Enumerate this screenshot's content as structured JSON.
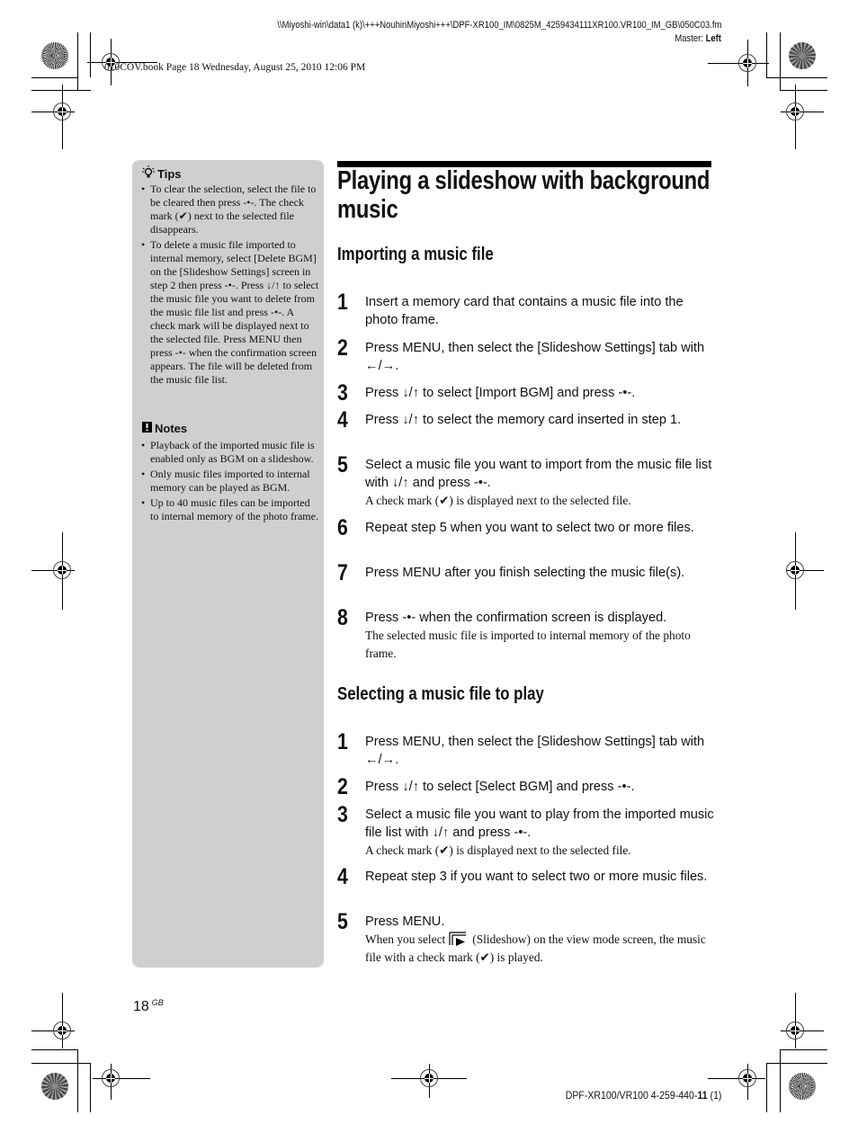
{
  "header": {
    "file_path": "\\\\Miyoshi-win\\data1 (k)\\+++NouhinMiyoshi+++\\DPF-XR100_IM\\0825M_4259434111XR100.VR100_IM_GB\\050C03.fm",
    "master_label": "Master:",
    "master_value": "Left",
    "book_info": "010COV.book  Page 18  Wednesday, August 25, 2010  12:06 PM"
  },
  "sidebar": {
    "tips": {
      "icon": "lightbulb-icon",
      "heading": "Tips",
      "items": [
        "To clear the selection, select the file to be cleared then press -•-. The check mark (✔) next to the selected file disappears.",
        "To delete a music file imported to internal memory, select [Delete BGM] on the [Slideshow Settings] screen in step 2 then press -•-. Press ↓/↑ to select the music file you want to delete from the music file list and press -•-. A check mark will be displayed next to the selected file. Press MENU then press -•- when the confirmation screen appears. The file will be deleted from the music file list."
      ]
    },
    "notes": {
      "icon": "exclamation-icon",
      "heading": "Notes",
      "items": [
        "Playback of the imported music file is enabled only as BGM on a slideshow.",
        "Only music files imported to internal memory can be played as BGM.",
        "Up to 40 music files can be imported to internal memory of the photo frame."
      ]
    }
  },
  "main": {
    "title": "Playing a slideshow with background music",
    "sections": [
      {
        "heading": "Importing a music file",
        "steps": [
          {
            "num": "1",
            "text": "Insert a memory card that contains a music file into the photo frame.",
            "sub": ""
          },
          {
            "num": "2",
            "text": "Press MENU, then select the [Slideshow Settings] tab with ←/→.",
            "sub": ""
          },
          {
            "num": "3",
            "text": "Press ↓/↑ to select [Import BGM] and press -•-.",
            "sub": ""
          },
          {
            "num": "4",
            "text": "Press ↓/↑ to select the memory card inserted in step 1.",
            "sub": ""
          },
          {
            "num": "5",
            "text": "Select a music file you want to import from the music file list with ↓/↑ and press -•-.",
            "sub": "A check mark (✔) is displayed next to the selected file."
          },
          {
            "num": "6",
            "text": "Repeat step 5 when you want to select two or more files.",
            "sub": ""
          },
          {
            "num": "7",
            "text": "Press MENU after you finish selecting the music file(s).",
            "sub": ""
          },
          {
            "num": "8",
            "text": "Press -•- when the confirmation screen is displayed.",
            "sub": "The selected music file is imported to internal memory of the photo frame."
          }
        ]
      },
      {
        "heading": "Selecting a music file to play",
        "steps": [
          {
            "num": "1",
            "text": "Press MENU, then select the [Slideshow Settings] tab with ←/→.",
            "sub": ""
          },
          {
            "num": "2",
            "text": "Press ↓/↑ to select [Select BGM] and press -•-.",
            "sub": ""
          },
          {
            "num": "3",
            "text": "Select a music file you want to play from the imported music file list with ↓/↑ and press -•-.",
            "sub": "A check mark (✔) is displayed next to the selected file."
          },
          {
            "num": "4",
            "text": "Repeat step 3 if you want to select two or more music files.",
            "sub": ""
          },
          {
            "num": "5",
            "text": "Press MENU.",
            "sub_before_icon": "When you select",
            "sub_icon": "slideshow-icon",
            "sub_after_icon": "(Slideshow) on the view mode screen, the music file with a check mark (✔)  is played."
          }
        ]
      }
    ]
  },
  "footer": {
    "page_number": "18",
    "page_suffix": "GB",
    "code_prefix": "DPF-XR100/VR100 4-259-440-",
    "code_bold": "11",
    "code_suffix": " (1)"
  }
}
